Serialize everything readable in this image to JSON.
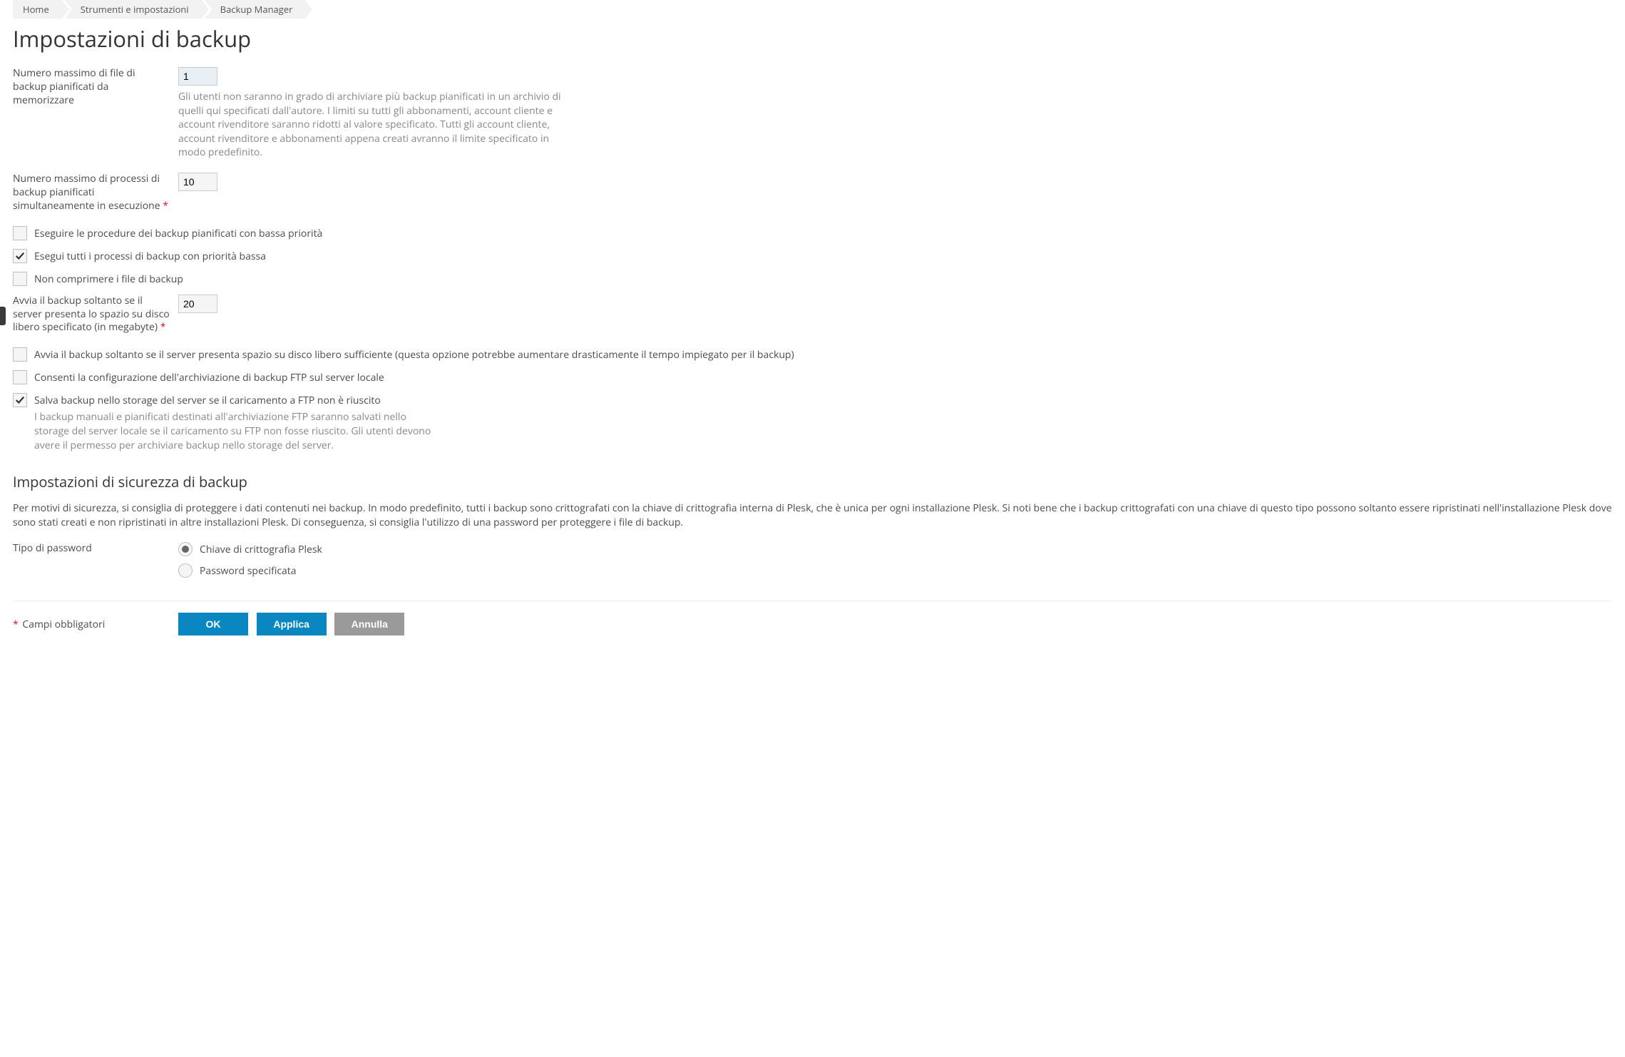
{
  "breadcrumbs": [
    "Home",
    "Strumenti e impostazioni",
    "Backup Manager"
  ],
  "page_title": "Impostazioni di backup",
  "fields": {
    "max_files": {
      "label": "Numero massimo di file di backup pianificati da memorizzare",
      "value": "1",
      "hint": "Gli utenti non saranno in grado di archiviare più backup pianificati in un archivio di quelli qui specificati dall'autore. I limiti su tutti gli abbonamenti, account cliente e account rivenditore saranno ridotti al valore specificato. Tutti gli account cliente, account rivenditore e abbonamenti appena creati avranno il limite specificato in modo predefinito."
    },
    "max_processes": {
      "label": "Numero massimo di processi di backup pianificati simultaneamente in esecuzione",
      "value": "10"
    },
    "disk_space": {
      "label": "Avvia il backup soltanto se il server presenta lo spazio su disco libero specificato (in megabyte)",
      "value": "20"
    }
  },
  "checkboxes": {
    "low_priority_scheduled": {
      "label": "Eseguire le procedure dei backup pianificati con bassa priorità",
      "checked": false
    },
    "low_priority_all": {
      "label": "Esegui tutti i processi di backup con priorità bassa",
      "checked": true
    },
    "no_compress": {
      "label": "Non comprimere i file di backup",
      "checked": false
    },
    "free_space_check": {
      "label": "Avvia il backup soltanto se il server presenta spazio su disco libero sufficiente (questa opzione potrebbe aumentare drasticamente il tempo impiegato per il backup)",
      "checked": false
    },
    "allow_ftp_local": {
      "label": "Consenti la configurazione dell'archiviazione di backup FTP sul server locale",
      "checked": false
    },
    "save_server_if_ftp_fail": {
      "label": "Salva backup nello storage del server se il caricamento a FTP non è riuscito",
      "checked": true,
      "hint": "I backup manuali e pianificati destinati all'archiviazione FTP saranno salvati nello storage del server locale se il caricamento su FTP non fosse riuscito. Gli utenti devono avere il permesso per archiviare backup nello storage del server."
    }
  },
  "security": {
    "title": "Impostazioni di sicurezza di backup",
    "text": "Per motivi di sicurezza, si consiglia di proteggere i dati contenuti nei backup. In modo predefinito, tutti i backup sono crittografati con la chiave di crittografia interna di Plesk, che è unica per ogni installazione Plesk. Si noti bene che i backup crittografati con una chiave di questo tipo possono soltanto essere ripristinati nell'installazione Plesk dove sono stati creati e non ripristinati in altre installazioni Plesk. Di conseguenza, si consiglia l'utilizzo di una password per proteggere i file di backup.",
    "password_type_label": "Tipo di password",
    "radios": {
      "plesk_key": {
        "label": "Chiave di crittografia Plesk",
        "selected": true
      },
      "specified": {
        "label": "Password specificata",
        "selected": false
      }
    }
  },
  "footer": {
    "required_label": "Campi obbligatori",
    "ok": "OK",
    "apply": "Applica",
    "cancel": "Annulla"
  }
}
